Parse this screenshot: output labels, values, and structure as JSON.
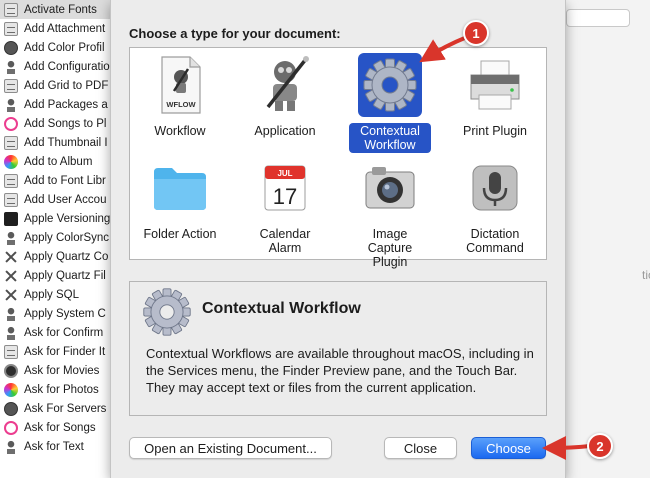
{
  "library": {
    "items": [
      {
        "label": "Activate Fonts",
        "icon": "document-icon"
      },
      {
        "label": "Add Attachment",
        "icon": "mail-icon"
      },
      {
        "label": "Add Color Profil",
        "icon": "color-profile-icon"
      },
      {
        "label": "Add Configuratio",
        "icon": "robot-icon"
      },
      {
        "label": "Add Grid to PDF",
        "icon": "document-icon"
      },
      {
        "label": "Add Packages a",
        "icon": "robot-icon"
      },
      {
        "label": "Add Songs to Pl",
        "icon": "music-icon"
      },
      {
        "label": "Add Thumbnail I",
        "icon": "document-icon"
      },
      {
        "label": "Add to Album",
        "icon": "photos-icon"
      },
      {
        "label": "Add to Font Libr",
        "icon": "document-icon"
      },
      {
        "label": "Add User Accou",
        "icon": "document-icon"
      },
      {
        "label": "Apple Versioning",
        "icon": "terminal-icon"
      },
      {
        "label": "Apply ColorSync",
        "icon": "robot-icon"
      },
      {
        "label": "Apply Quartz Co",
        "icon": "tools-icon"
      },
      {
        "label": "Apply Quartz Fil",
        "icon": "tools-icon"
      },
      {
        "label": "Apply SQL",
        "icon": "tools-icon"
      },
      {
        "label": "Apply System C",
        "icon": "robot-icon"
      },
      {
        "label": "Ask for Confirm",
        "icon": "robot-icon"
      },
      {
        "label": "Ask for Finder It",
        "icon": "document-icon"
      },
      {
        "label": "Ask for Movies",
        "icon": "movies-icon"
      },
      {
        "label": "Ask for Photos",
        "icon": "photos-icon"
      },
      {
        "label": "Ask For Servers",
        "icon": "globe-icon"
      },
      {
        "label": "Ask for Songs",
        "icon": "music-icon"
      },
      {
        "label": "Ask for Text",
        "icon": "robot-icon"
      }
    ]
  },
  "sheet": {
    "prompt": "Choose a type for your document:",
    "types": [
      {
        "label": "Workflow",
        "icon_text": "WFLOW"
      },
      {
        "label": "Application"
      },
      {
        "label": "Contextual Workflow"
      },
      {
        "label": "Print Plugin"
      },
      {
        "label": "Folder Action"
      },
      {
        "label": "Calendar Alarm",
        "icon_month": "JUL",
        "icon_day": "17"
      },
      {
        "label": "Image Capture Plugin"
      },
      {
        "label": "Dictation Command"
      }
    ],
    "selected_index": 2,
    "description": {
      "title": "Contextual Workflow",
      "text": "Contextual Workflows are available throughout macOS, including in the Services menu, the Finder Preview pane, and the Touch Bar. They may accept text or files from the current application."
    },
    "buttons": {
      "open_existing": "Open an Existing Document...",
      "close": "Close",
      "choose": "Choose"
    }
  },
  "annotations": [
    {
      "label": "1"
    },
    {
      "label": "2"
    }
  ],
  "side_text": "tio",
  "colors": {
    "selection_blue": "#2754c6",
    "primary_button": "#1b69f0",
    "annotation_red": "#d9352b"
  }
}
